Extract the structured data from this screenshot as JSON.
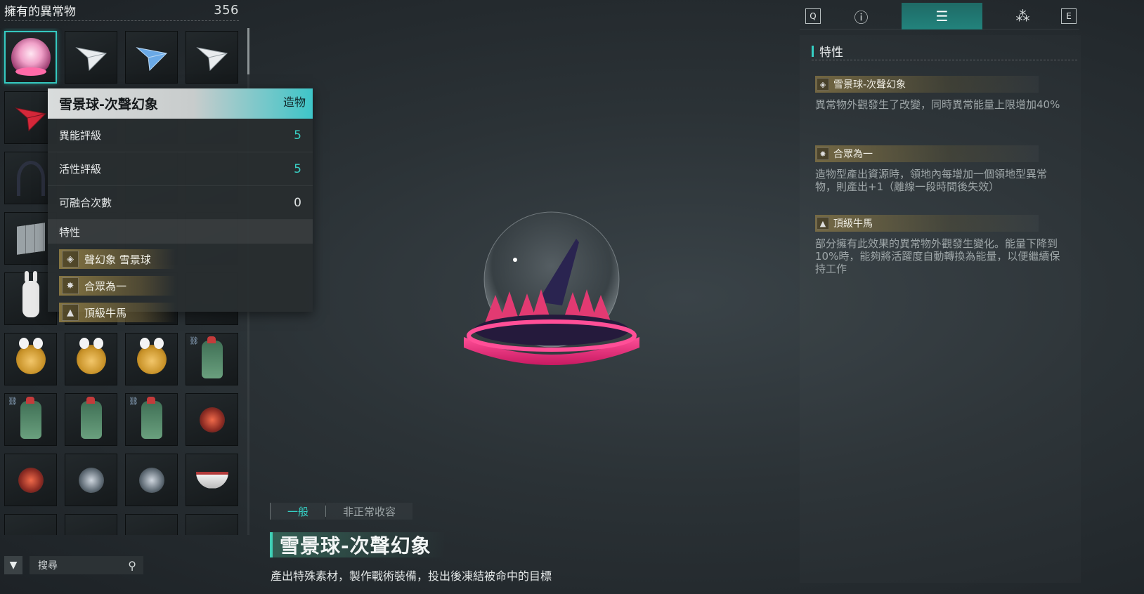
{
  "inventory": {
    "title": "擁有的異常物",
    "count": "356",
    "items": [
      {
        "icon": "snow-globe-icon"
      },
      {
        "icon": "white-plane-icon"
      },
      {
        "icon": "blue-plane-icon"
      },
      {
        "icon": "white-plane-icon"
      },
      {
        "icon": "red-plane-icon"
      },
      {
        "icon": "hidden"
      },
      {
        "icon": "hidden"
      },
      {
        "icon": "hidden"
      },
      {
        "icon": "tentacle-icon"
      },
      {
        "icon": "hidden"
      },
      {
        "icon": "hidden"
      },
      {
        "icon": "hidden"
      },
      {
        "icon": "metal-cube-icon"
      },
      {
        "icon": "hidden"
      },
      {
        "icon": "hidden"
      },
      {
        "icon": "hidden"
      },
      {
        "icon": "bunny-icon"
      },
      {
        "icon": "dim-item-icon"
      },
      {
        "icon": "dim-item-icon"
      },
      {
        "icon": "dim-item-icon"
      },
      {
        "icon": "bee-icon"
      },
      {
        "icon": "bee-icon"
      },
      {
        "icon": "bee-icon"
      },
      {
        "icon": "dino-icon",
        "linked": true
      },
      {
        "icon": "dino-icon",
        "linked": true
      },
      {
        "icon": "dino-icon"
      },
      {
        "icon": "dino-icon",
        "linked": true
      },
      {
        "icon": "red-drone-icon"
      },
      {
        "icon": "red-drone-icon"
      },
      {
        "icon": "grey-drone-icon"
      },
      {
        "icon": "grey-drone-icon"
      },
      {
        "icon": "bowl-icon"
      },
      {
        "icon": "dim-item-icon"
      },
      {
        "icon": "dim-item-icon"
      },
      {
        "icon": "dim-item-icon"
      },
      {
        "icon": "dim-item-icon"
      }
    ]
  },
  "popup": {
    "name": "雪景球-次聲幻象",
    "type": "造物",
    "stats": [
      {
        "label": "異能評級",
        "value": "5"
      },
      {
        "label": "活性評級",
        "value": "5"
      },
      {
        "label": "可融合次數",
        "value": "0"
      }
    ],
    "traits_header": "特性",
    "traits": [
      {
        "label": "聲幻象  雪景球",
        "icon": "diamond-icon"
      },
      {
        "label": "合眾為一",
        "icon": "snowflake-icon"
      },
      {
        "label": "頂級牛馬",
        "icon": "mountain-icon"
      }
    ]
  },
  "search": {
    "placeholder": "搜尋"
  },
  "detail": {
    "tabs": [
      "一般",
      "非正常收容"
    ],
    "name": "雪景球-次聲幻象",
    "description": "產出特殊素材，製作戰術裝備，投出後凍結被命中的目標"
  },
  "topbar": {
    "key_left": "Q",
    "key_right": "E",
    "icons": [
      "info-icon",
      "list-icon",
      "nodes-icon"
    ],
    "active_index": 1
  },
  "traits_panel": {
    "title": "特性",
    "items": [
      {
        "name": "雪景球-次聲幻象",
        "icon": "diamond-icon",
        "desc": "異常物外觀發生了改變，同時異常能量上限增加40%"
      },
      {
        "name": "合眾為一",
        "icon": "snowflake-icon",
        "desc": "造物型產出資源時，領地內每增加一個領地型異常物，則產出+1（離線一段時間後失效）"
      },
      {
        "name": "頂級牛馬",
        "icon": "mountain-icon",
        "desc": "部分擁有此效果的異常物外觀發生變化。能量下降到10%時，能夠將活躍度自動轉換為能量，以便繼續保持工作"
      }
    ]
  },
  "colors": {
    "accent": "#35cfc4",
    "trait_gold": "#968246",
    "popup_head_gradient_end": "#3ec5c8"
  }
}
